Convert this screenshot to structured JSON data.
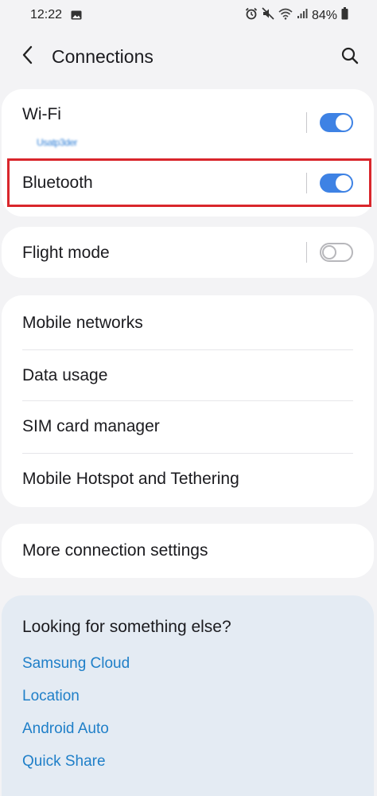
{
  "status_bar": {
    "time": "12:22",
    "battery": "84%",
    "icons": [
      "image-icon",
      "alarm-icon",
      "mute-icon",
      "wifi-icon",
      "signal-icon",
      "battery-icon"
    ]
  },
  "app_bar": {
    "title": "Connections",
    "back_icon": "chevron-left-icon",
    "search_icon": "search-icon"
  },
  "toggle_card": {
    "wifi": {
      "label": "Wi-Fi",
      "network": "Usatp3der",
      "enabled": true
    },
    "bluetooth": {
      "label": "Bluetooth",
      "enabled": true,
      "highlighted": true
    }
  },
  "flight_card": {
    "flight_mode": {
      "label": "Flight mode",
      "enabled": false
    }
  },
  "network_card": {
    "items": [
      {
        "label": "Mobile networks"
      },
      {
        "label": "Data usage"
      },
      {
        "label": "SIM card manager"
      },
      {
        "label": "Mobile Hotspot and Tethering"
      }
    ]
  },
  "more_card": {
    "label": "More connection settings"
  },
  "suggestions": {
    "title": "Looking for something else?",
    "links": [
      {
        "label": "Samsung Cloud"
      },
      {
        "label": "Location"
      },
      {
        "label": "Android Auto"
      },
      {
        "label": "Quick Share"
      }
    ]
  },
  "colors": {
    "background": "#f3f3f5",
    "card": "#ffffff",
    "toggle_on": "#3e82e4",
    "link": "#1f7fc8",
    "highlight": "#d9262c",
    "suggest_bg": "#e4ebf3"
  }
}
